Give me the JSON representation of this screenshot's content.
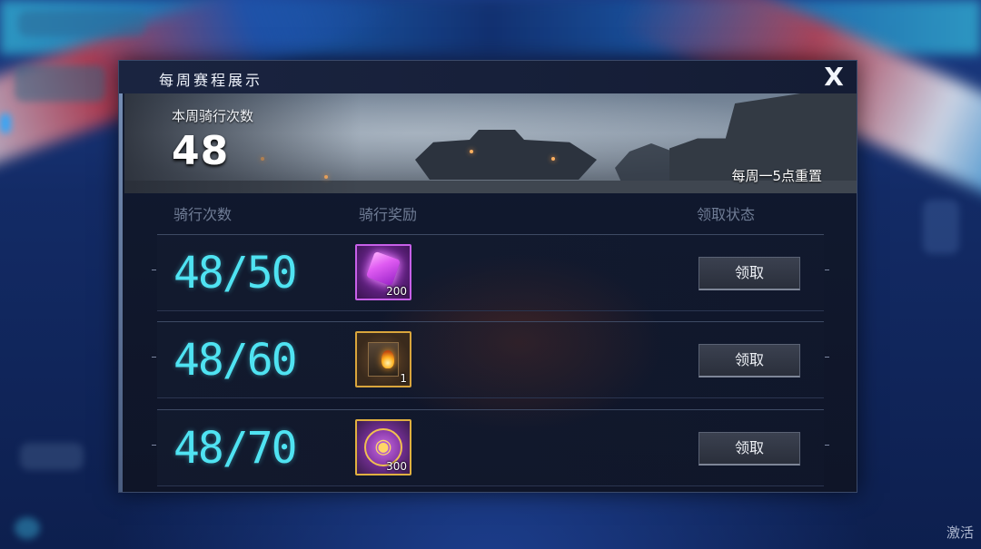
{
  "dialog": {
    "title": "每周赛程展示",
    "close_label": "X",
    "banner": {
      "week_label": "本周骑行次数",
      "week_count": "48",
      "reset_note": "每周一5点重置"
    },
    "columns": [
      "骑行次数",
      "骑行奖励",
      "领取状态"
    ],
    "rows": [
      {
        "progress": "48/50",
        "reward_icon": "purple-gem-icon",
        "reward_qty": "200",
        "claim_label": "领取"
      },
      {
        "progress": "48/60",
        "reward_icon": "fire-crate-icon",
        "reward_qty": "1",
        "claim_label": "领取"
      },
      {
        "progress": "48/70",
        "reward_icon": "motorbike-coin-icon",
        "reward_qty": "300",
        "claim_label": "领取"
      }
    ]
  },
  "watermark": "激活",
  "colors": {
    "progress_text": "#4fe3f2",
    "dialog_bg": "#111a30",
    "button_bg": "#2f3440"
  }
}
